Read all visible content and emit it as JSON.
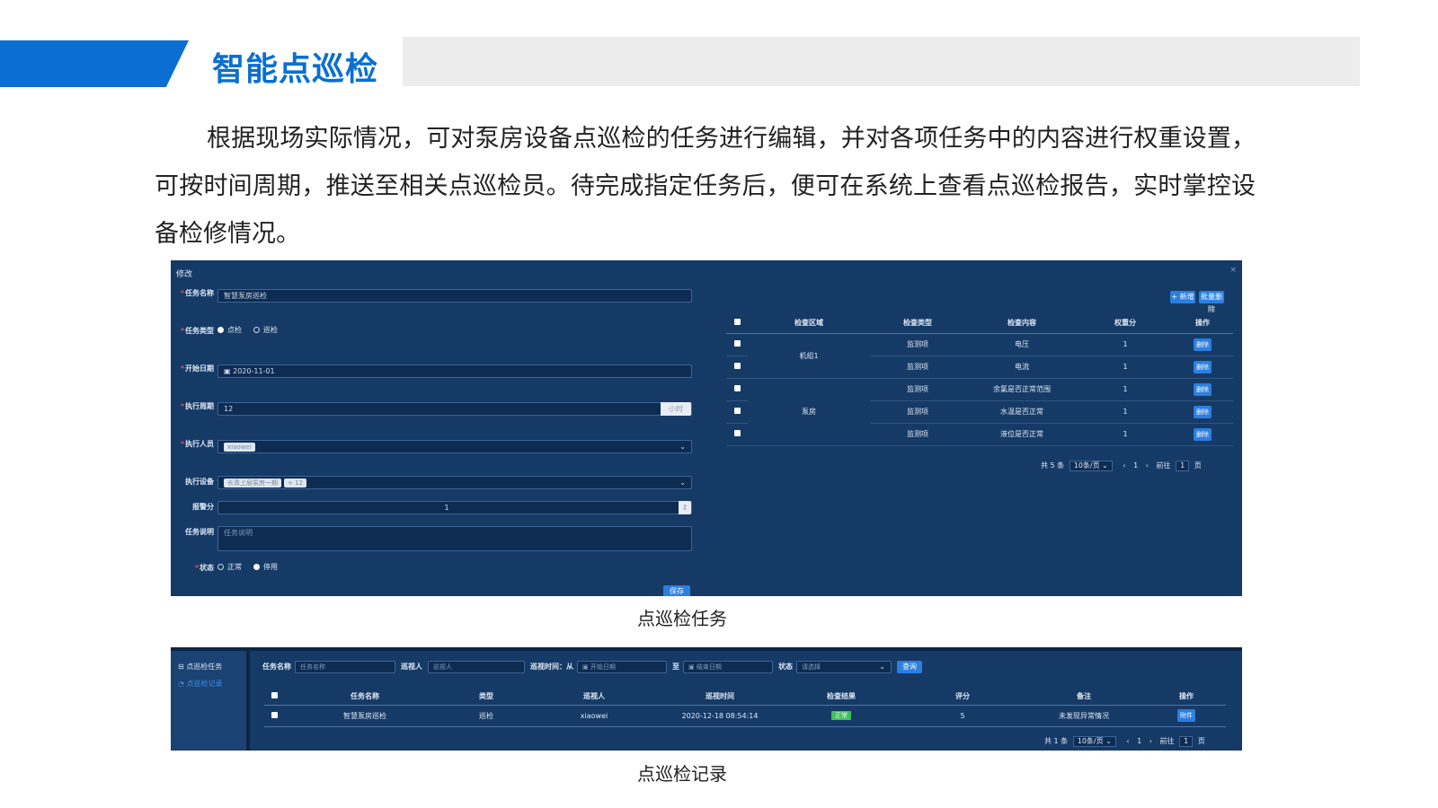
{
  "header": {
    "title": "智能点巡检"
  },
  "intro": "根据现场实际情况，可对泵房设备点巡检的任务进行编辑，并对各项任务中的内容进行权重设置，可按时间周期，推送至相关点巡检员。待完成指定任务后，便可在系统上查看点巡检报告，实时掌控设备检修情况。",
  "colors": {
    "accent": "#0a6fd1",
    "panel_bg": "#163a66",
    "button": "#2b7fe0"
  },
  "edit_panel": {
    "title": "修改",
    "close": "×",
    "fields": {
      "task_name": {
        "label": "任务名称",
        "value": "智慧泵房巡检"
      },
      "task_type": {
        "label": "任务类型",
        "options": [
          "点检",
          "巡检"
        ],
        "selected": "点检"
      },
      "start_date": {
        "label": "开始日期",
        "value": "2020-11-01"
      },
      "period": {
        "label": "执行周期",
        "value": "12",
        "unit": "小时"
      },
      "executor": {
        "label": "执行人员",
        "tag": "xiaowei"
      },
      "device": {
        "label": "执行设备",
        "tag": "长青上层泵房一期",
        "more": "+ 12"
      },
      "alarm_score": {
        "label": "报警分",
        "value": "1"
      },
      "description": {
        "label": "任务说明",
        "placeholder": "任务说明"
      },
      "status": {
        "label": "状态",
        "options": [
          "正常",
          "停用"
        ],
        "selected": "停用"
      }
    },
    "save_label": "保存",
    "right": {
      "add_label": "+ 新增",
      "del_label": "批量删除",
      "columns": [
        "检查区域",
        "检查类型",
        "检查内容",
        "权重分",
        "操作"
      ],
      "rows": [
        {
          "area": "机组1",
          "type": "监测项",
          "content": "电压",
          "weight": "1",
          "op": "删除"
        },
        {
          "area": "",
          "type": "监测项",
          "content": "电流",
          "weight": "1",
          "op": "删除"
        },
        {
          "area": "",
          "type": "监测项",
          "content": "余氯是否正常范围",
          "weight": "1",
          "op": "删除"
        },
        {
          "area": "泵房",
          "type": "监测项",
          "content": "水温是否正常",
          "weight": "1",
          "op": "删除"
        },
        {
          "area": "",
          "type": "监测项",
          "content": "液位是否正常",
          "weight": "1",
          "op": "删除"
        }
      ],
      "pager": {
        "total": "共 5 条",
        "size": "10条/页",
        "page": "1",
        "goto": "前往",
        "goto_value": "1",
        "suffix": "页"
      }
    }
  },
  "caption1": "点巡检任务",
  "record_panel": {
    "sidebar": [
      "点巡检任务",
      "点巡检记录"
    ],
    "filters": {
      "task_name": {
        "label": "任务名称",
        "placeholder": "任务名称"
      },
      "inspector": {
        "label": "巡视人",
        "placeholder": "巡视人"
      },
      "time": {
        "label": "巡视时间：",
        "from": "从",
        "start_placeholder": "开始日期",
        "to": "至",
        "end_placeholder": "结束日期"
      },
      "status": {
        "label": "状态",
        "placeholder": "请选择"
      },
      "query_label": "查询"
    },
    "columns": [
      "任务名称",
      "类型",
      "巡视人",
      "巡视时间",
      "检查结果",
      "评分",
      "备注",
      "操作"
    ],
    "rows": [
      {
        "name": "智慧泵房巡检",
        "type": "巡检",
        "inspector": "xiaowei",
        "time": "2020-12-18 08:54:14",
        "result": "正常",
        "score": "5",
        "note": "未发现异常情况",
        "op": "附件"
      }
    ],
    "pager": {
      "total": "共 1 条",
      "size": "10条/页",
      "page": "1",
      "goto": "前往",
      "goto_value": "1",
      "suffix": "页"
    }
  },
  "caption2": "点巡检记录"
}
